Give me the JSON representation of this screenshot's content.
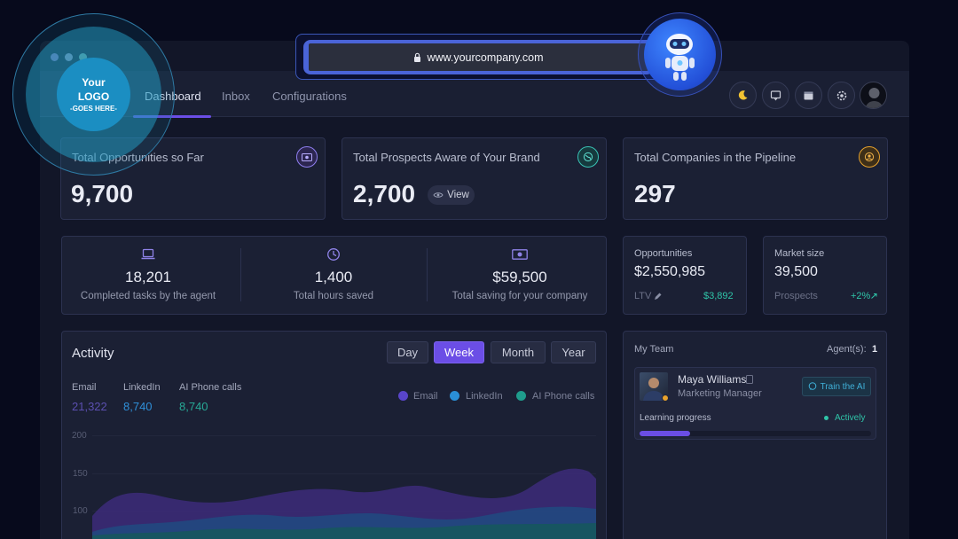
{
  "browser": {
    "url": "www.yourcompany.com"
  },
  "logo": {
    "line1": "Your",
    "line2": "LOGO",
    "line3": "-GOES HERE-"
  },
  "nav": {
    "tabs": [
      {
        "label": "Dashboard"
      },
      {
        "label": "Inbox"
      },
      {
        "label": "Configurations"
      }
    ]
  },
  "kpis": [
    {
      "title": "Total Opportunities so Far",
      "value": "9,700",
      "icon": "money-icon",
      "color": "#8f7ff0"
    },
    {
      "title": "Total Prospects Aware of Your Brand",
      "value": "2,700",
      "view_label": "View",
      "icon": "globe-icon",
      "color": "#39c2b5"
    },
    {
      "title": "Total Companies in the Pipeline",
      "value": "297",
      "icon": "company-icon",
      "color": "#e8a22c"
    }
  ],
  "stats": [
    {
      "value": "18,201",
      "label": "Completed tasks by the agent",
      "icon": "laptop-icon"
    },
    {
      "value": "1,400",
      "label": "Total hours saved",
      "icon": "clock-icon"
    },
    {
      "value": "$59,500",
      "label": "Total saving for your company",
      "icon": "cash-icon"
    }
  ],
  "opportunities": {
    "title": "Opportunities",
    "value": "$2,550,985",
    "ltv_label": "LTV",
    "ltv_value": "$3,892"
  },
  "market": {
    "title": "Market size",
    "value": "39,500",
    "sub_label": "Prospects",
    "change": "+2%"
  },
  "activity": {
    "title": "Activity",
    "periods": [
      "Day",
      "Week",
      "Month",
      "Year"
    ],
    "selected": "Week",
    "metrics": [
      {
        "label": "Email",
        "value": "21,322",
        "color": "#5b4fb0"
      },
      {
        "label": "LinkedIn",
        "value": "8,740",
        "color": "#2f8fd8"
      },
      {
        "label": "AI Phone calls",
        "value": "8,740",
        "color": "#27a996"
      }
    ],
    "legend": [
      {
        "label": "Email",
        "color": "#5945c9"
      },
      {
        "label": "LinkedIn",
        "color": "#2a8fd6"
      },
      {
        "label": "AI Phone calls",
        "color": "#1f9c8c"
      }
    ],
    "yticks": [
      "200",
      "150",
      "100"
    ]
  },
  "team": {
    "title": "My Team",
    "agents_label": "Agent(s):",
    "agents_count": "1",
    "member": {
      "name": "Maya Williams",
      "role": "Marketing Manager",
      "train_label": "Train the AI",
      "progress_label": "Learning progress",
      "status": "Actively",
      "progress": 0.22
    }
  }
}
